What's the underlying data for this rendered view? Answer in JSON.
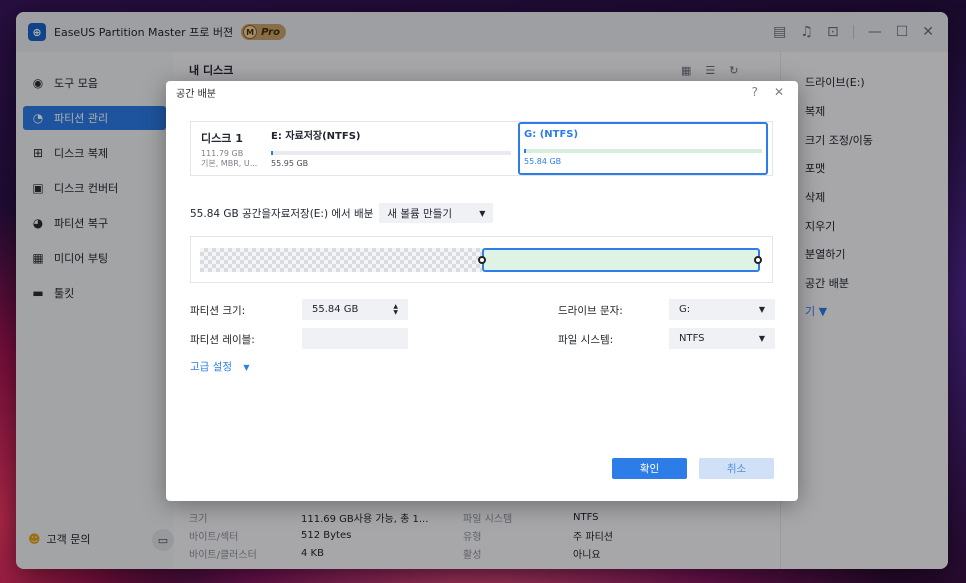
{
  "app": {
    "title": "EaseUS Partition Master",
    "edition": "프로 버젼",
    "badge_letter": "M",
    "badge_label": "Pro"
  },
  "sidebar": {
    "items": [
      {
        "label": "도구 모음",
        "icon": "compass-icon"
      },
      {
        "label": "파티션 관리",
        "icon": "pie-chart-icon",
        "active": true
      },
      {
        "label": "디스크 복제",
        "icon": "copy-plus-icon"
      },
      {
        "label": "디스크 컨버터",
        "icon": "disk-convert-icon"
      },
      {
        "label": "파티션 복구",
        "icon": "recover-icon"
      },
      {
        "label": "미디어 부팅",
        "icon": "boot-media-icon"
      },
      {
        "label": "툴킷",
        "icon": "toolbox-icon"
      }
    ],
    "support_label": "고객 문의"
  },
  "main": {
    "disk_title": "내 디스크"
  },
  "right_panel": {
    "items": [
      "드라이브(E:)",
      "복제",
      "크기 조정/이동",
      "포맷",
      "삭제",
      "지우기",
      "분열하기",
      "공간 배분"
    ],
    "more_label": "기 ▼"
  },
  "bottom_info": {
    "rows": [
      {
        "k1": "크기",
        "v1": "111.69 GB사용 가능, 총 1...",
        "k2": "파일 시스템",
        "v2": "NTFS"
      },
      {
        "k1": "바이트/섹터",
        "v1": "512 Bytes",
        "k2": "유형",
        "v2": "주 파티션"
      },
      {
        "k1": "바이트/클러스터",
        "v1": "4 KB",
        "k2": "활성",
        "v2": "아니요"
      }
    ]
  },
  "dialog": {
    "title": "공간 배분",
    "help_icon": "?",
    "close_icon": "✕",
    "disk": {
      "name": "디스크 1",
      "size": "111.79 GB",
      "info": "기본, MBR, U..."
    },
    "partitions": [
      {
        "title_prefix": "E: ",
        "title": "자료저장(NTFS)",
        "size": "55.95 GB",
        "used_fraction": 0.01
      },
      {
        "title": "G: (NTFS)",
        "size": "55.84 GB",
        "used_fraction": 0.01
      }
    ],
    "allocate_text": "55.84 GB 공간을자료저장(E:) 에서 배분",
    "allocate_select": "새 볼륨 만들기",
    "partition_size_label": "파티션 크기:",
    "partition_size_value": "55.84 GB",
    "partition_label_label": "파티션 레이블:",
    "partition_label_value": "",
    "drive_letter_label": "드라이브 문자:",
    "drive_letter_value": "G:",
    "file_system_label": "파일 시스템:",
    "file_system_value": "NTFS",
    "advanced_label": "고급 설정",
    "ok_label": "확인",
    "cancel_label": "취소"
  },
  "colors": {
    "accent": "#2d7de8",
    "new_partition_fill": "#def3e3"
  }
}
